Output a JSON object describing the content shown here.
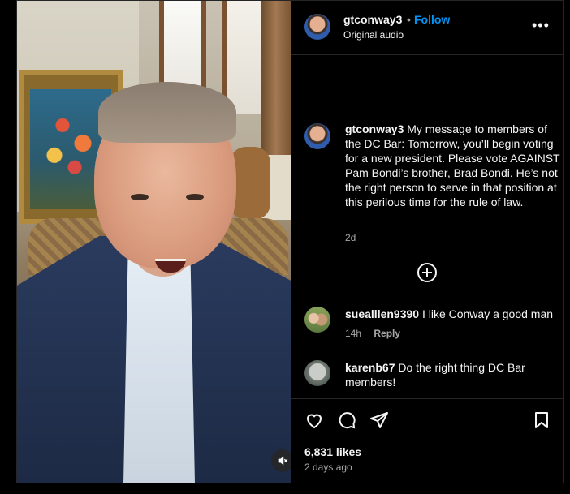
{
  "post": {
    "username": "gtconway3",
    "follow_label": "Follow",
    "dot": "•",
    "audio_label": "Original audio",
    "more_label": "•••"
  },
  "caption": {
    "username": "gtconway3",
    "text": "My message to members of the DC Bar: Tomorrow, you’ll begin voting for a new president. Please vote AGAINST Pam Bondi’s brother, Brad Bondi. He’s not the right person to serve in that position at this perilous time for the rule of law.",
    "time": "2d"
  },
  "comments": [
    {
      "username": "suealllen9390",
      "text": "I like Conway a good man",
      "time": "14h",
      "reply_label": "Reply"
    },
    {
      "username": "karenb67",
      "text": "Do the right thing DC Bar members!"
    }
  ],
  "stats": {
    "likes": "6,831 likes",
    "posted": "2 days ago"
  },
  "icons": {
    "like": "heart-icon",
    "comment": "comment-icon",
    "share": "share-icon",
    "save": "bookmark-icon",
    "mute": "speaker-muted-icon",
    "load_more": "plus-circle-icon",
    "more": "more-options-icon"
  },
  "colors": {
    "accent": "#0095f6",
    "background": "#000000",
    "text": "#f5f5f5",
    "secondary": "#a8a8a8"
  }
}
